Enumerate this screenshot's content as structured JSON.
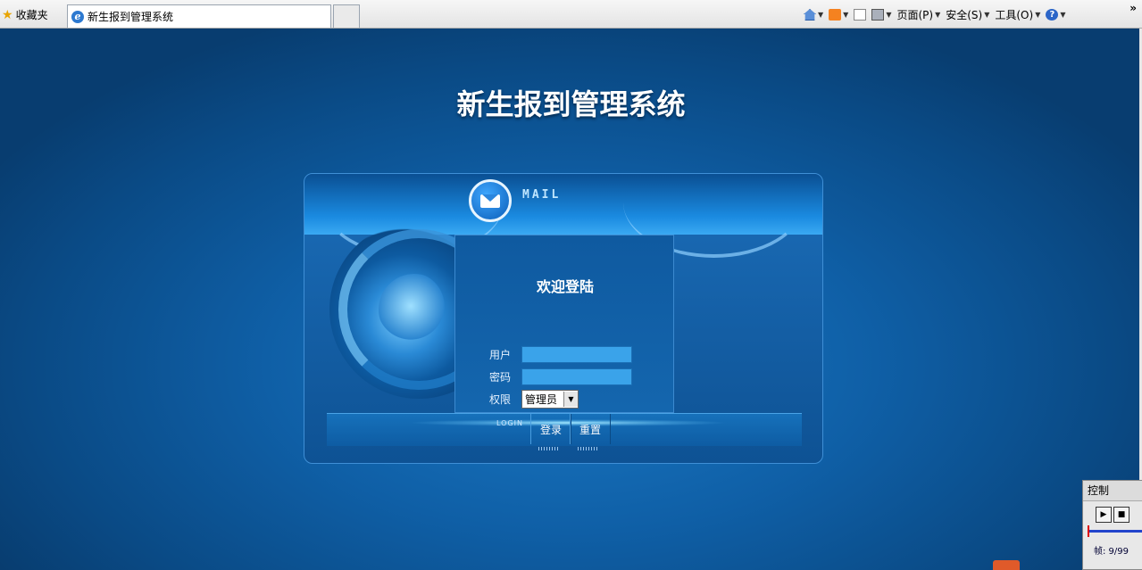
{
  "browser": {
    "favorites_label": "收藏夹",
    "tab_title": "新生报到管理系统",
    "commands": {
      "page": "页面(P)",
      "safety": "安全(S)",
      "tools": "工具(O)"
    },
    "icons": [
      "home-icon",
      "rss-icon",
      "mail-icon",
      "print-icon",
      "help-icon"
    ],
    "more": "»"
  },
  "page": {
    "system_title": "新生报到管理系统",
    "logo_word": "MAIL",
    "welcome": "欢迎登陆",
    "fields": {
      "user_label": "用户",
      "user_value": "",
      "password_label": "密码",
      "password_value": "",
      "role_label": "权限",
      "role_value": "管理员"
    },
    "login_word": "LOGIN",
    "login_button": "登录",
    "reset_button": "重置"
  },
  "control_panel": {
    "title": "控制",
    "frame_text": "帧: 9/99"
  },
  "colors": {
    "page_bg": "#0f5fa6",
    "input_bg": "#3aa3ea",
    "accent": "#1a8ae0"
  }
}
